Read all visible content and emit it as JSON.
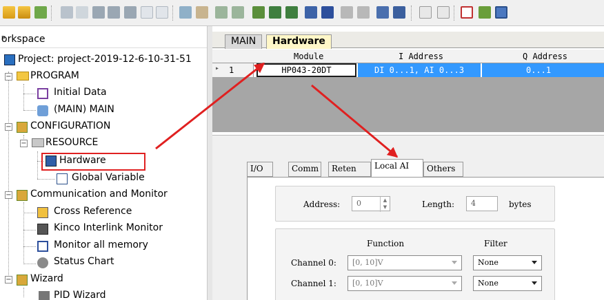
{
  "colors": {
    "accent": "#3399ff",
    "annotation": "#e02020",
    "active_tab": "#fff7c8"
  },
  "toolbar": {
    "icons": [
      "open-folder-icon",
      "open-icon",
      "toggle-icon",
      "cut-icon",
      "copy-icon",
      "paste-icon",
      "paste-special-icon",
      "paste-alt-icon",
      "undo-icon",
      "redo-icon",
      "compile-icon",
      "compile-all-icon",
      "network-icon",
      "network-alt-icon",
      "chart-icon",
      "grid-icon",
      "download-icon",
      "upload-icon",
      "glasses-icon",
      "table-icon",
      "lock-icon",
      "lock-alt-icon",
      "table-edit-icon",
      "memory-icon",
      "doc-icon",
      "doc-alt-icon",
      "window-icon",
      "window-split-icon",
      "window-active-icon"
    ]
  },
  "workspace": {
    "title": "orkspace",
    "pin": "ᵖ",
    "tree": [
      {
        "label": "Project: project-2019-12-6-10-31-51",
        "icon": "project-icon"
      },
      {
        "label": "PROGRAM",
        "icon": "folder-icon"
      },
      {
        "label": "Initial Data",
        "icon": "table-icon"
      },
      {
        "label": "(MAIN)  MAIN",
        "icon": "program-icon"
      },
      {
        "label": "CONFIGURATION",
        "icon": "config-icon"
      },
      {
        "label": "RESOURCE",
        "icon": "resource-folder-icon"
      },
      {
        "label": "Hardware",
        "icon": "hardware-icon"
      },
      {
        "label": "Global Variable",
        "icon": "variable-icon"
      },
      {
        "label": "Communication and Monitor",
        "icon": "config-icon"
      },
      {
        "label": "Cross Reference",
        "icon": "cross-ref-icon"
      },
      {
        "label": "Kinco Interlink Monitor",
        "icon": "monitor-icon"
      },
      {
        "label": "Monitor all memory",
        "icon": "memory-grid-icon"
      },
      {
        "label": "Status Chart",
        "icon": "status-chart-icon"
      },
      {
        "label": "Wizard",
        "icon": "config-icon"
      },
      {
        "label": "PID Wizard",
        "icon": "pid-icon"
      }
    ]
  },
  "tabs": {
    "main": "MAIN",
    "hardware": "Hardware"
  },
  "grid": {
    "headers": {
      "module": "Module",
      "i_address": "I Address",
      "q_address": "Q Address"
    },
    "rows": [
      {
        "marker": "▸",
        "num": "1",
        "module": "HP043-20DT",
        "i_address": "DI 0...1, AI 0...3",
        "q_address": "0...1"
      }
    ]
  },
  "props": {
    "tabs": [
      "I/O",
      "Comm",
      "Reten",
      "Local AI",
      "Others"
    ],
    "active_tab": "Local AI",
    "address_label": "Address:",
    "address_value": "0",
    "length_label": "Length:",
    "length_value": "4",
    "bytes_label": "bytes",
    "function_header": "Function",
    "filter_header": "Filter",
    "channels": [
      {
        "label": "Channel 0:",
        "function": "[0, 10]V",
        "filter": "None"
      },
      {
        "label": "Channel 1:",
        "function": "[0, 10]V",
        "filter": "None"
      }
    ]
  }
}
